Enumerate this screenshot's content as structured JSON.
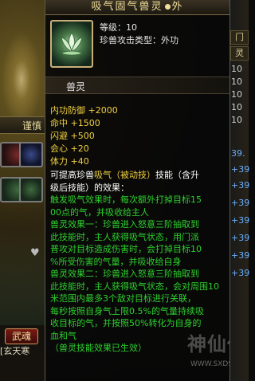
{
  "tooltip": {
    "title_left": "吸气固气兽灵",
    "title_right": "外",
    "level_label": "等级：10",
    "attack_type": "珍兽攻击类型：外功",
    "section_label": "兽灵",
    "stats": [
      "内功防御 +2000",
      "命中 +1500",
      "闪避 +500",
      "会心 +20",
      "体力 +40"
    ],
    "intro": {
      "a": "可提高珍兽",
      "b": "吸气（被动技）",
      "c": "技能（含升",
      "d": "级后技能）的效果："
    },
    "desc_lines": [
      "触发吸气效果时，每次额外打掉目标15",
      "00点的气，并吸收给主人",
      "兽灵效果一：珍兽进入怒意三阶抽取到",
      "此技能时，主人获得吸气状态，用门派",
      "普攻对目标造成伤害时，会打掉目标10",
      "%所受伤害的气量，并吸收给自身",
      "兽灵效果二：珍兽进入怒意三阶抽取到",
      "此技能时，主人获得吸气状态，会对周围10",
      "米范围内最多3个敌对目标进行关联，",
      "每秒按照自身气上限0.5%的气量持续吸",
      "收目标的气，并按照50%转化为自身的",
      "血和气"
    ],
    "footer": "（兽灵技能效果已生效）"
  },
  "left": {
    "tab_label": "谨慎",
    "wuhun_label": "武魂",
    "name_label": "[玄天寒"
  },
  "right": {
    "tab1": "门",
    "tab2": "灵",
    "nums": [
      "10",
      "10",
      "10",
      "10",
      "10",
      "39.",
      "+39",
      "+39",
      "+39",
      "+39",
      "+39",
      "+39",
      "+39"
    ]
  },
  "watermark": {
    "text": "神仙代售",
    "url": "WWW.SXDS.COM"
  },
  "colors": {
    "stat": "#f0d040",
    "effect_green": "#2ed12e",
    "title_gold": "#f2df9a"
  }
}
